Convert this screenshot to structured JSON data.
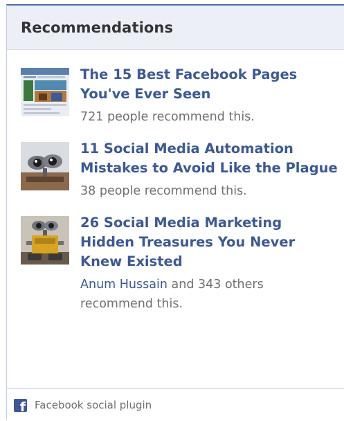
{
  "header": {
    "title": "Recommendations"
  },
  "items": [
    {
      "title": "The 15 Best Facebook Pages You've Ever Seen",
      "meta": "721 people recommend this."
    },
    {
      "title": "11 Social Media Automation Mistakes to Avoid Like the Plague",
      "meta": "38 people recommend this."
    },
    {
      "title": "26 Social Media Marketing Hidden Treasures You Never Knew Existed",
      "meta_link": "Anum Hussain",
      "meta_rest": " and 343 others recommend this."
    }
  ],
  "footer": {
    "label": "Facebook social plugin",
    "icon": "facebook-icon"
  },
  "colors": {
    "link": "#3b5998",
    "header_bg": "#eceff5",
    "muted_text": "#6d7071",
    "border_accent": "#4e6ab0"
  }
}
